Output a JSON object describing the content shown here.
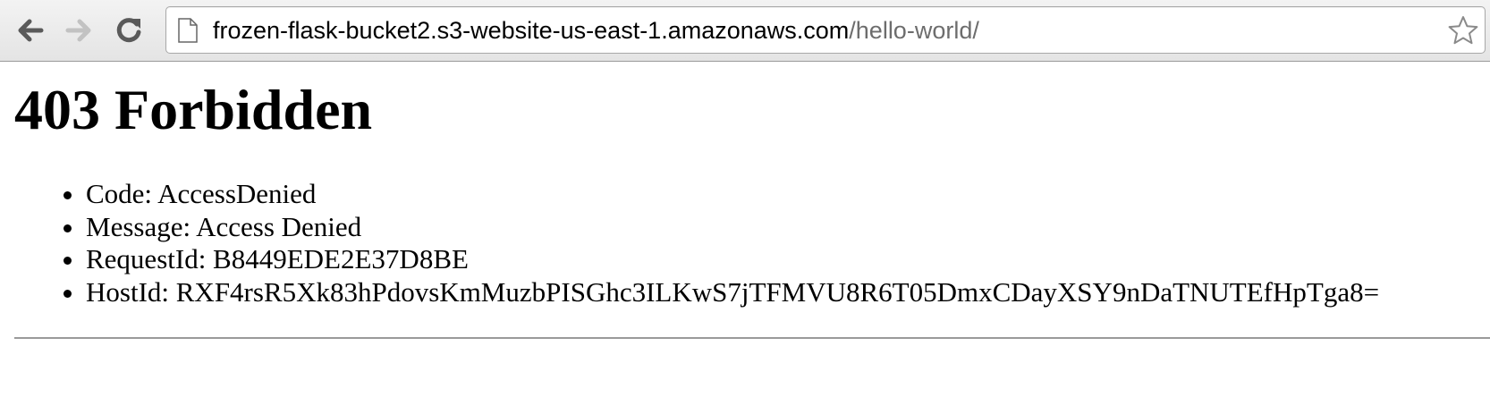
{
  "browser": {
    "url_host": "frozen-flask-bucket2.s3-website-us-east-1.amazonaws.com",
    "url_path": "/hello-world/",
    "icons": {
      "back": "back-arrow-icon",
      "forward": "forward-arrow-icon",
      "reload": "reload-icon",
      "page": "page-icon",
      "bookmark": "star-icon"
    }
  },
  "page": {
    "heading": "403 Forbidden",
    "details": [
      "Code: AccessDenied",
      "Message: Access Denied",
      "RequestId: B8449EDE2E37D8BE",
      "HostId: RXF4rsR5Xk83hPdovsKmMuzbPISGhc3ILKwS7jTFMVU8R6T05DmxCDayXSY9nDaTNUTEfHpTga8="
    ]
  }
}
